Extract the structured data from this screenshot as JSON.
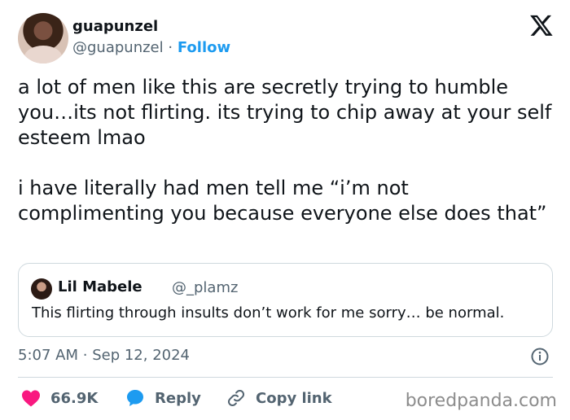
{
  "author": {
    "name": "guapunzel",
    "handle": "@guapunzel",
    "separator": "·",
    "follow_label": "Follow"
  },
  "post": {
    "paragraphs": [
      "a lot of men like this are secretly trying to humble you…its not flirting. its trying to chip away at your self esteem lmao",
      "i have literally had men tell me “i’m not complimenting you because everyone else does that”"
    ]
  },
  "quote": {
    "name": "Lil Mabele",
    "handle": "@_plamz",
    "text": "This flirting through insults don’t work for me sorry… be normal."
  },
  "timestamp": {
    "time": "5:07 AM",
    "separator": "·",
    "date": "Sep 12, 2024"
  },
  "actions": {
    "likes": "66.9K",
    "reply_label": "Reply",
    "copy_link_label": "Copy link"
  },
  "watermark": "boredpanda.com",
  "colors": {
    "accent": "#1d9bf0",
    "like": "#f91880",
    "secondary_text": "#536471"
  },
  "icons": [
    "x-logo-icon",
    "info-icon",
    "heart-icon",
    "reply-bubble-icon",
    "link-icon"
  ]
}
